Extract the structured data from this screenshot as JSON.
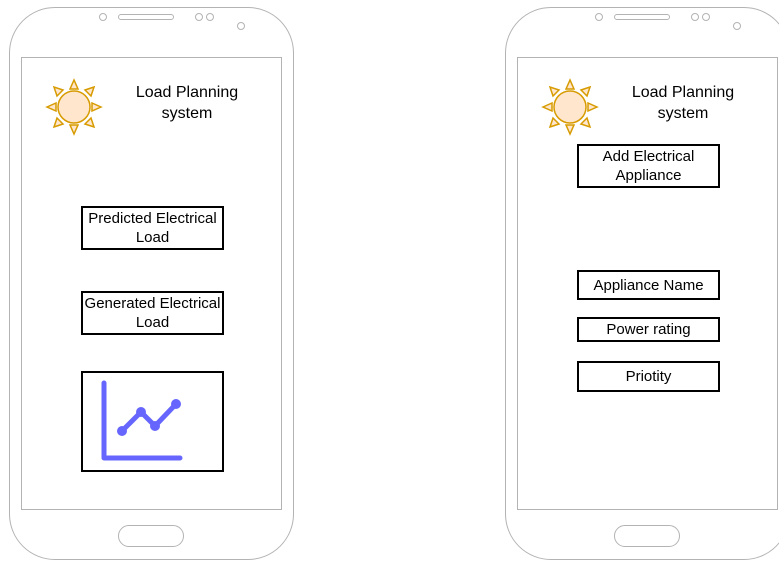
{
  "left_screen": {
    "title": "Load Planning system",
    "buttons": [
      {
        "label": "Predicted Electrical Load"
      },
      {
        "label": "Generated Electrical Load"
      }
    ],
    "chart_icon_color": "#6666ff"
  },
  "right_screen": {
    "title": "Load Planning system",
    "add_button_label": "Add Electrical Appliance",
    "fields": [
      {
        "label": "Appliance Name"
      },
      {
        "label": "Power rating"
      },
      {
        "label": "Priotity"
      }
    ]
  },
  "icons": {
    "logo": "sun-icon",
    "chart": "line-chart-icon"
  },
  "colors": {
    "sun_fill": "#ffe6cc",
    "sun_stroke": "#d79b00",
    "phone_outline": "#b3b3b3",
    "chart": "#6666ff"
  }
}
